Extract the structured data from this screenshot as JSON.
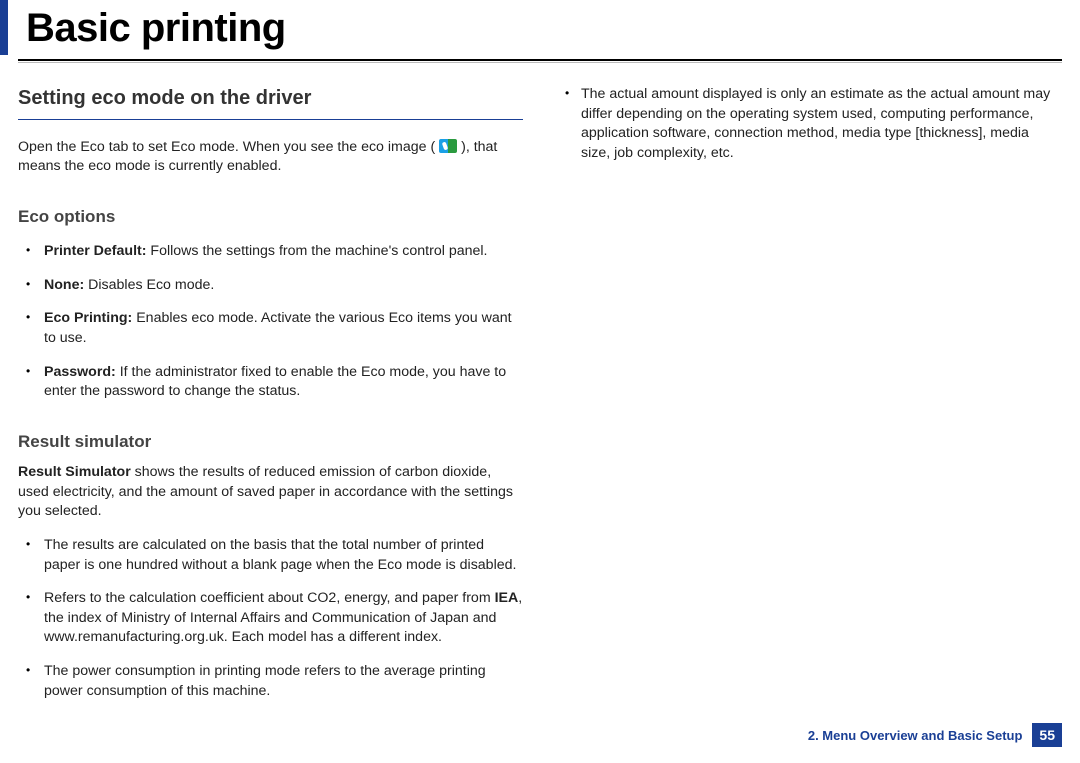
{
  "header": {
    "title": "Basic printing"
  },
  "left": {
    "section_title": "Setting eco mode on the driver",
    "intro_a": "Open the Eco tab to set Eco mode. When you see the eco image ( ",
    "intro_b": " ), that means the eco mode is currently enabled.",
    "eco_options": {
      "heading": "Eco options",
      "items": [
        {
          "label": "Printer Default:",
          "text": " Follows the settings from the machine's control panel."
        },
        {
          "label": "None:",
          "text": " Disables Eco mode."
        },
        {
          "label": "Eco Printing:",
          "text": " Enables eco mode. Activate the various Eco items you want to use."
        },
        {
          "label": "Password:",
          "text": " If the administrator fixed to enable the Eco mode, you have to enter the password to change the status."
        }
      ]
    },
    "result_sim": {
      "heading": "Result simulator",
      "intro_label": "Result Simulator",
      "intro_text": " shows the results of reduced emission of carbon dioxide, used electricity, and the amount of saved paper in accordance with the settings you selected.",
      "items": [
        "The results are calculated on the basis that the total number of printed paper is one hundred without a blank page when the Eco mode is disabled.",
        {
          "pre": "Refers to the calculation coefficient about CO2, energy, and paper from ",
          "bold": "IEA",
          "post": ", the index of Ministry of Internal Affairs and Communication of Japan and www.remanufacturing.org.uk. Each model has a different index."
        },
        "The power consumption in printing mode refers to the average printing power consumption of this machine."
      ]
    }
  },
  "right": {
    "items": [
      "The actual amount displayed is only an estimate as the actual amount may differ depending on the operating system used, computing performance, application software, connection method, media type [thickness], media size, job complexity, etc."
    ]
  },
  "footer": {
    "chapter": "2. Menu Overview and Basic Setup",
    "page": "55"
  }
}
